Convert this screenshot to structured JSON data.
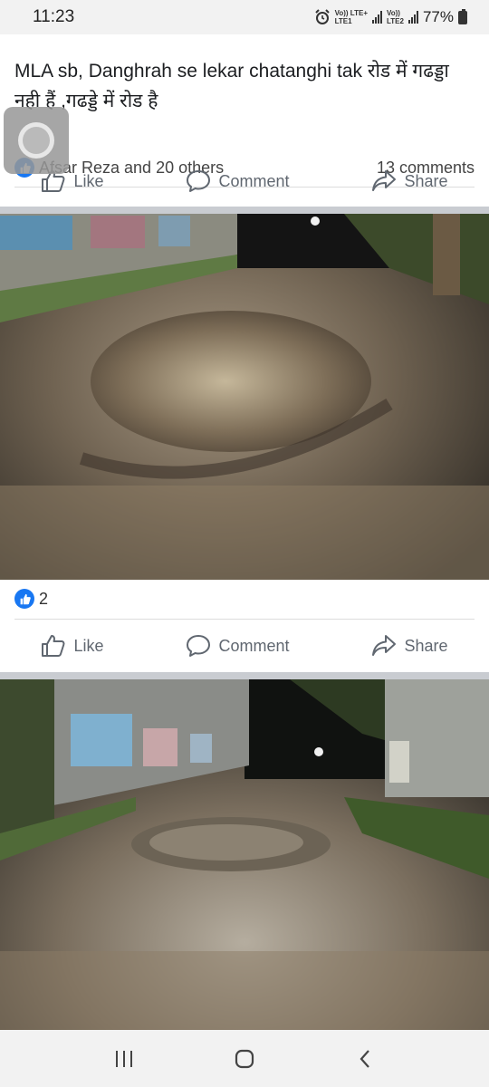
{
  "status_bar": {
    "time": "11:23",
    "net1_top": "Vo)) LTE+",
    "net1_bottom": "LTE1",
    "net2_top": "Vo))",
    "net2_bottom": "LTE2",
    "battery": "77%"
  },
  "post": {
    "text": "MLA sb, Danghrah se lekar chatanghi tak रोड में गढड्डा   नही हैं ,गढड्डे में रोड है",
    "reactors": "Afsar Reza and 20 others",
    "comments": "13 comments",
    "actions": {
      "like": "Like",
      "comment": "Comment",
      "share": "Share"
    }
  },
  "photo1": {
    "reaction_count": "2",
    "actions": {
      "like": "Like",
      "comment": "Comment",
      "share": "Share"
    }
  },
  "colors": {
    "facebook_blue": "#1877f2"
  },
  "icons": [
    "like-thumb-icon",
    "comment-bubble-icon",
    "share-arrow-icon",
    "recents-icon",
    "home-icon",
    "back-icon"
  ]
}
